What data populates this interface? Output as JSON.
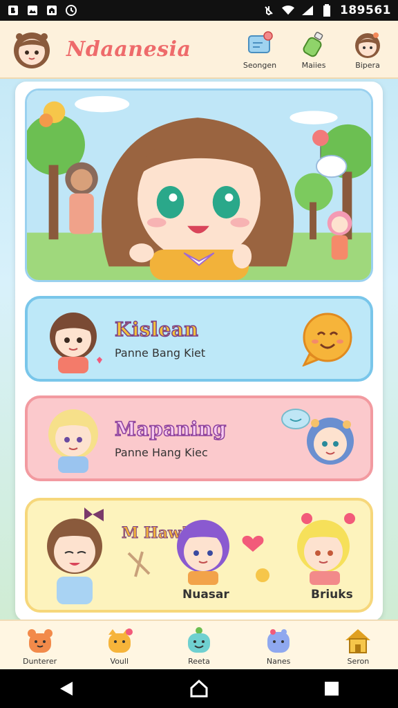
{
  "status_bar": {
    "time": "189561",
    "icons": [
      "n-icon",
      "mail-icon",
      "photo-icon",
      "clock-icon",
      "mute-icon",
      "wifi-icon",
      "signal-icon",
      "battery-icon"
    ]
  },
  "header": {
    "title": "Ndaanesia",
    "actions": [
      {
        "label": "Seongen",
        "icon": "card-icon"
      },
      {
        "label": "Maiies",
        "icon": "bottle-icon"
      },
      {
        "label": "Bipera",
        "icon": "avatar-icon"
      }
    ]
  },
  "cards": [
    {
      "title": "Kislean",
      "subtitle": "Panne Bang Kiet",
      "color": "#bde8f8"
    },
    {
      "title": "Mapaning",
      "subtitle": "Panne Hang Kiec",
      "color": "#fbc9cc"
    },
    {
      "labels": [
        "Nuasar",
        "Briuks"
      ],
      "sticker_text": "M Haw!",
      "color": "#fdf3bd"
    }
  ],
  "bottom_nav": [
    {
      "label": "Dunterer",
      "icon": "bear-icon"
    },
    {
      "label": "Voull",
      "icon": "cat-icon"
    },
    {
      "label": "Reeta",
      "icon": "dino-icon"
    },
    {
      "label": "Nanes",
      "icon": "monster-icon"
    },
    {
      "label": "Seron",
      "icon": "house-icon"
    }
  ],
  "colors": {
    "accent": "#ee6b6b",
    "header_bg": "#fdf1dc",
    "blue": "#79c6ea",
    "pink": "#f29aa0",
    "yellow": "#f6d77b"
  }
}
